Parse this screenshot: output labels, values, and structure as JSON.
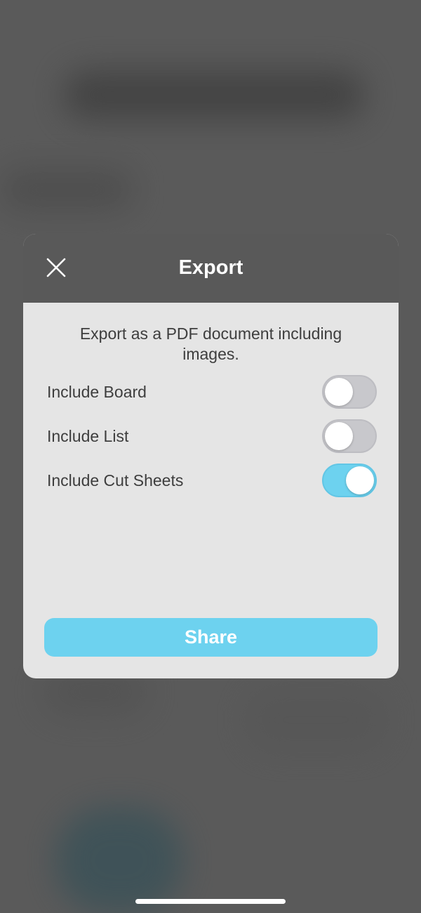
{
  "modal": {
    "title": "Export",
    "description": "Export as a PDF document including images.",
    "options": [
      {
        "label": "Include Board",
        "enabled": false
      },
      {
        "label": "Include List",
        "enabled": false
      },
      {
        "label": "Include Cut Sheets",
        "enabled": true
      }
    ],
    "share_label": "Share"
  },
  "icons": {
    "close": "close-icon"
  },
  "colors": {
    "accent": "#6dd2ef",
    "header": "#595959",
    "panel": "#e5e5e5",
    "backdrop": "#5a5a5a",
    "toggle_off": "#c8c8cc",
    "text": "#3e3e3e"
  }
}
